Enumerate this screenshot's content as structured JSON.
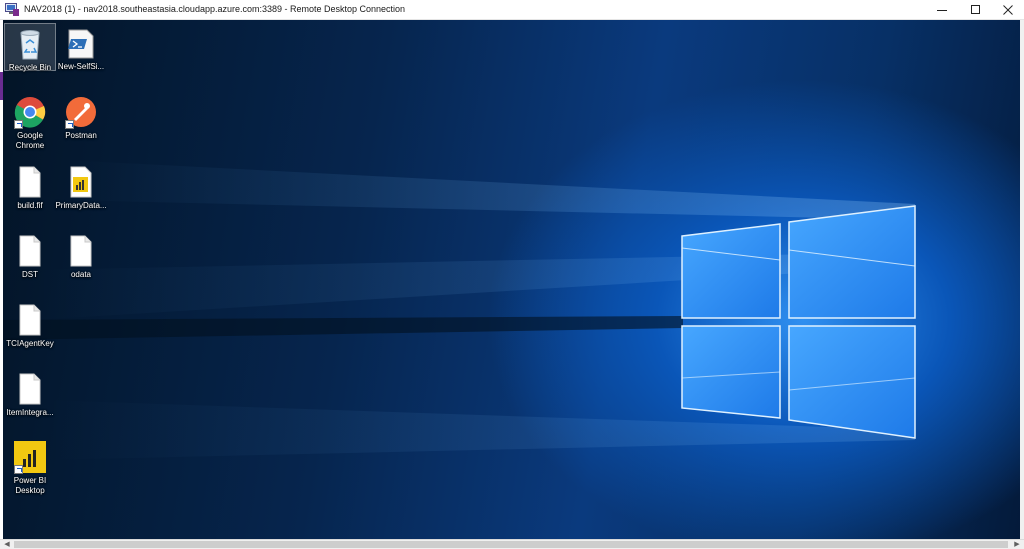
{
  "window": {
    "title": "NAV2018 (1) - nav2018.southeastasia.cloudapp.azure.com:3389 - Remote Desktop Connection",
    "app_icon": "remote-desktop-icon",
    "buttons": {
      "minimize_icon": "minimize-icon",
      "maximize_icon": "maximize-icon",
      "close_icon": "close-icon"
    }
  },
  "desktop": {
    "wallpaper": "windows-10-light-window",
    "colors": {
      "deep": "#031426",
      "mid": "#0a3a7e",
      "glow": "#4aa8ff"
    },
    "icons": [
      {
        "label": "Recycle Bin",
        "icon": "recycle-bin-icon",
        "selected": true
      },
      {
        "label": "New-SelfSi...",
        "icon": "powershell-script-icon"
      },
      {
        "label": "Google Chrome",
        "icon": "chrome-icon"
      },
      {
        "label": "Postman",
        "icon": "postman-icon"
      },
      {
        "label": "build.fif",
        "icon": "file-icon"
      },
      {
        "label": "PrimaryData...",
        "icon": "powerbi-file-icon"
      },
      {
        "label": "DST",
        "icon": "file-icon"
      },
      {
        "label": "odata",
        "icon": "file-icon"
      },
      {
        "label": "TCIAgentKey",
        "icon": "file-icon"
      },
      {
        "label": "ItemIntegra...",
        "icon": "file-icon"
      },
      {
        "label": "Power BI Desktop",
        "icon": "powerbi-desktop-icon"
      }
    ]
  }
}
